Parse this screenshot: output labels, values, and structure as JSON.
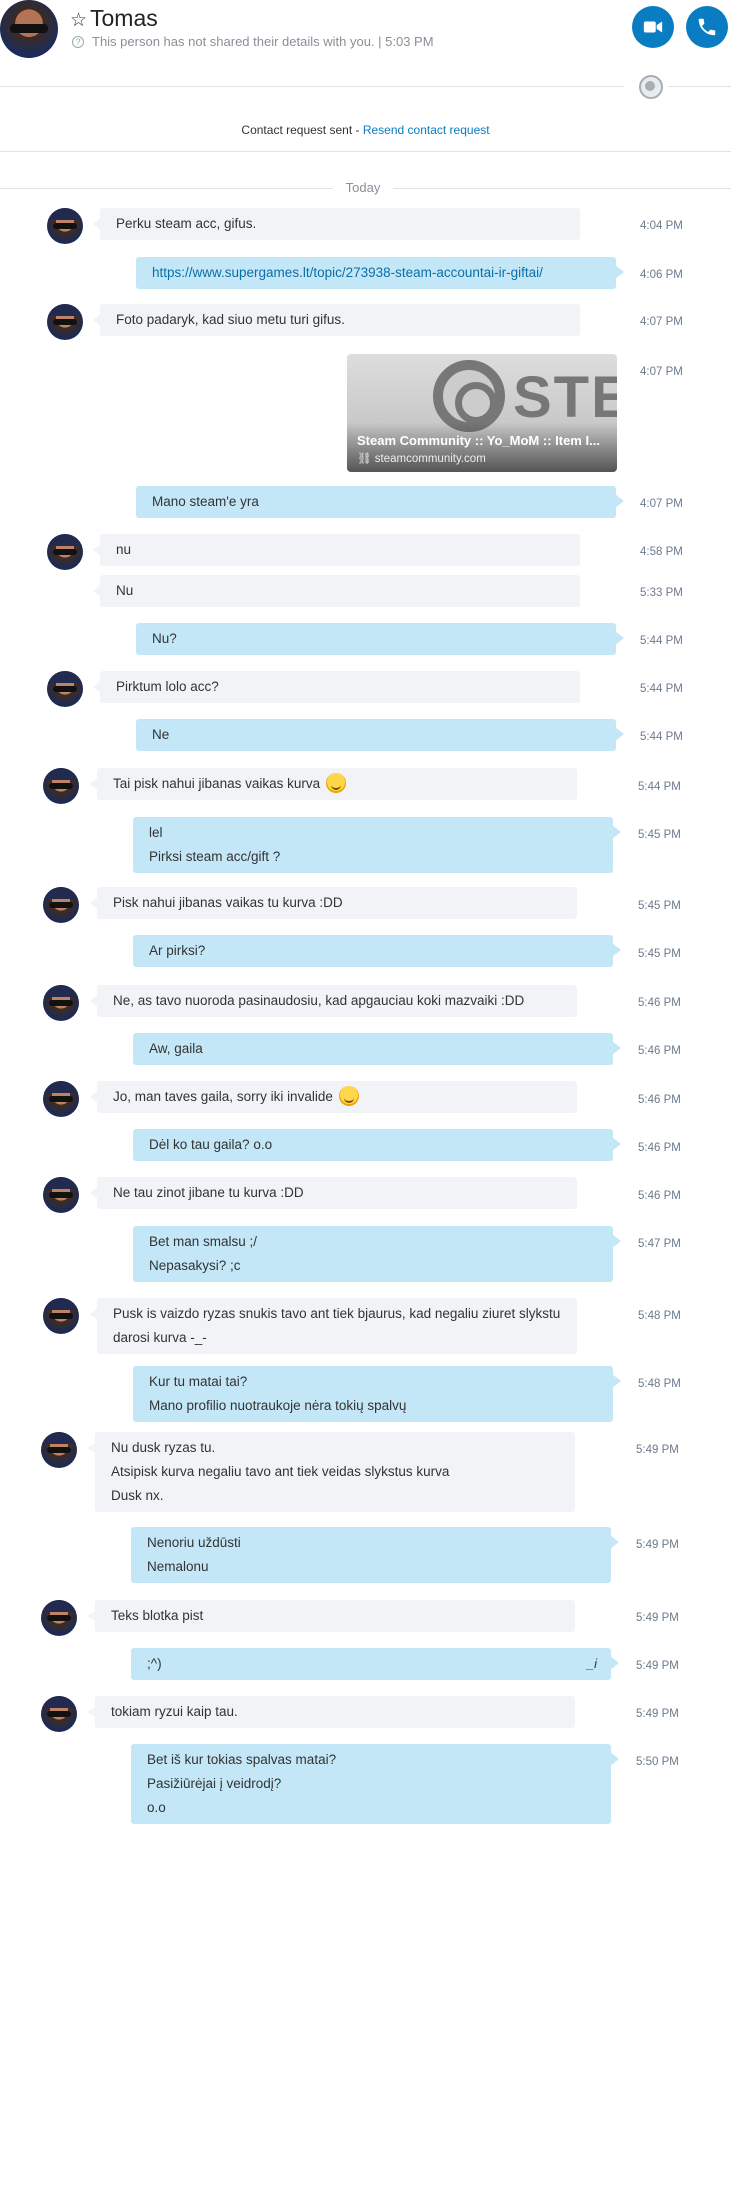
{
  "header": {
    "contact_name": "Tomas",
    "status": "This person has not shared their details with you.  |  5:03 PM",
    "video_call_icon": "video-camera-icon",
    "audio_call_icon": "phone-icon"
  },
  "contact_request": {
    "text": "Contact request sent - ",
    "link": "Resend contact request"
  },
  "day_separator": "Today",
  "messages": [
    {
      "id": "m1",
      "text": "Perku steam acc, gifus.",
      "time": "4:04 PM"
    },
    {
      "id": "m2",
      "text": "https://www.supergames.lt/topic/273938-steam-accountai-ir-giftai/",
      "time": "4:06 PM"
    },
    {
      "id": "m3",
      "text": "Foto padaryk, kad siuo metu turi gifus.",
      "time": "4:07 PM"
    },
    {
      "id": "m4",
      "card_title": "Steam Community :: Yo_MoM :: Item I...",
      "card_domain": "steamcommunity.com",
      "card_logo_text": "STE",
      "time": "4:07 PM"
    },
    {
      "id": "m5",
      "text": "Mano steam'e yra",
      "time": "4:07 PM"
    },
    {
      "id": "m6",
      "text": "nu",
      "time": "4:58 PM"
    },
    {
      "id": "m7",
      "text": "Nu",
      "time": "5:33 PM"
    },
    {
      "id": "m8",
      "text": "Nu?",
      "time": "5:44 PM"
    },
    {
      "id": "m9",
      "text": "Pirktum lolo acc?",
      "time": "5:44 PM"
    },
    {
      "id": "m10",
      "text": "Ne",
      "time": "5:44 PM"
    },
    {
      "id": "m11",
      "text": "Tai pisk nahui jibanas vaikas kurva",
      "time": "5:44 PM"
    },
    {
      "id": "m12",
      "lines": [
        "lel",
        "Pirksi steam acc/gift ?"
      ],
      "time": "5:45 PM"
    },
    {
      "id": "m13",
      "text": "Pisk nahui jibanas vaikas tu kurva :DD",
      "time": "5:45 PM"
    },
    {
      "id": "m14",
      "text": "Ar pirksi?",
      "time": "5:45 PM"
    },
    {
      "id": "m15",
      "text": "Ne, as tavo nuoroda pasinaudosiu, kad apgauciau koki mazvaiki :DD",
      "time": "5:46 PM"
    },
    {
      "id": "m16",
      "text": "Aw, gaila",
      "time": "5:46 PM"
    },
    {
      "id": "m17",
      "text": "Jo, man taves gaila, sorry iki invalide",
      "time": "5:46 PM"
    },
    {
      "id": "m18",
      "text": "Dėl ko tau gaila? o.o",
      "time": "5:46 PM"
    },
    {
      "id": "m19",
      "text": "Ne tau zinot jibane tu kurva :DD",
      "time": "5:46 PM"
    },
    {
      "id": "m20",
      "lines": [
        "Bet man smalsu ;/",
        "Nepasakysi? ;c"
      ],
      "time": "5:47 PM"
    },
    {
      "id": "m21",
      "lines": [
        "Pusk is vaizdo ryzas snukis tavo ant tiek bjaurus, kad negaliu ziuret slykstu",
        "darosi kurva -_-"
      ],
      "time": "5:48 PM"
    },
    {
      "id": "m22",
      "lines": [
        "Kur tu matai tai?",
        "Mano profilio nuotraukoje nėra tokių spalvų"
      ],
      "time": "5:48 PM"
    },
    {
      "id": "m23",
      "lines": [
        "Nu dusk ryzas tu.",
        "Atsipisk kurva negaliu tavo ant tiek veidas slykstus kurva",
        "Dusk nx."
      ],
      "time": "5:49 PM"
    },
    {
      "id": "m24",
      "lines": [
        "Nenoriu uždūsti",
        "Nemalonu"
      ],
      "time": "5:49 PM"
    },
    {
      "id": "m25",
      "text": "Teks blotka pist",
      "time": "5:49 PM"
    },
    {
      "id": "m26",
      "text": ";^)",
      "time": "5:49 PM"
    },
    {
      "id": "m27",
      "text": "tokiam ryzui kaip tau.",
      "time": "5:49 PM"
    },
    {
      "id": "m28",
      "lines": [
        "Bet iš kur tokias spalvas matai?",
        "Pasižiūrėjai į veidrodį?",
        "o.o"
      ],
      "time": "5:50 PM"
    }
  ]
}
